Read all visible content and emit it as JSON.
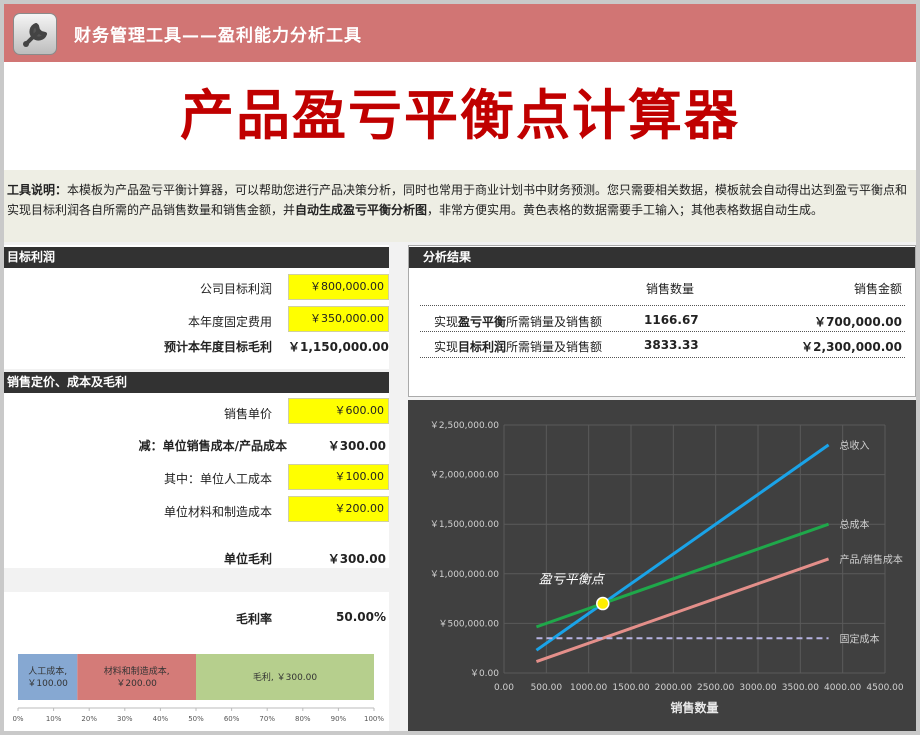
{
  "header": {
    "title": "财务管理工具——盈利能力分析工具",
    "icon": "wrench-icon"
  },
  "page_title": "产品盈亏平衡点计算器",
  "description": {
    "label": "工具说明：",
    "text1": "本模板为产品盈亏平衡计算器，可以帮助您进行产品决策分析，同时也常用于商业计划书中财务预测。您只需要相关数据，模板就会自动得出达到盈亏平衡点和实现目标利润各自所需的产品销售数量和销售金额，并",
    "bold": "自动生成盈亏平衡分析图",
    "text2": "，非常方便实用。黄色表格的数据需要手工输入；其他表格数据自动生成。"
  },
  "target_profit": {
    "title": "目标利润",
    "company_target_label": "公司目标利润",
    "company_target_value": "￥800,000.00",
    "fixed_cost_label": "本年度固定费用",
    "fixed_cost_value": "￥350,000.00",
    "target_gross_label": "预计本年度目标毛利",
    "target_gross_value": "￥1,150,000.00"
  },
  "pricing": {
    "title": "销售定价、成本及毛利",
    "unit_price_label": "销售单价",
    "unit_price_value": "￥600.00",
    "unit_cost_label": "减：单位销售成本/产品成本",
    "unit_cost_value": "￥300.00",
    "labor_label": "其中：单位人工成本",
    "labor_value": "￥100.00",
    "material_label": "单位材料和制造成本",
    "material_value": "￥200.00",
    "margin_label": "单位毛利",
    "margin_value": "￥300.00",
    "margin_rate_label": "毛利率",
    "margin_rate_value": "50.00%"
  },
  "analysis": {
    "title": "分析结果",
    "col_qty": "销售数量",
    "col_amt": "销售金额",
    "row1_prefix": "实现",
    "row1_bold": "盈亏平衡",
    "row1_suffix": "所需销量及销售额",
    "row1_qty": "1166.67",
    "row1_amt": "￥700,000.00",
    "row2_prefix": "实现",
    "row2_bold": "目标利润",
    "row2_suffix": "所需销量及销售额",
    "row2_qty": "3833.33",
    "row2_amt": "￥2,300,000.00"
  },
  "chart_data": [
    {
      "type": "line",
      "xlabel": "销售数量",
      "xlim": [
        0,
        4500
      ],
      "ylim": [
        0,
        2500000
      ],
      "x_ticks": [
        "0.00",
        "500.00",
        "1000.00",
        "1500.00",
        "2000.00",
        "2500.00",
        "3000.00",
        "3500.00",
        "4000.00",
        "4500.00"
      ],
      "y_ticks": [
        "￥0.00",
        "￥500,000.00",
        "￥1,000,000.00",
        "￥1,500,000.00",
        "￥2,000,000.00",
        "￥2,500,000.00"
      ],
      "x": [
        383.33,
        3833.33
      ],
      "series": [
        {
          "name": "总收入",
          "values": [
            230000,
            2300000
          ],
          "color": "#1aa3e8"
        },
        {
          "name": "总成本",
          "values": [
            465000,
            1500000
          ],
          "color": "#1fa84a"
        },
        {
          "name": "产品/销售成本",
          "values": [
            115000,
            1150000
          ],
          "color": "#e48f8a"
        },
        {
          "name": "固定成本",
          "values": [
            350000,
            350000
          ],
          "color": "#b6b3e2",
          "dashed": true
        }
      ],
      "annotation": {
        "label": "盈亏平衡点",
        "x": 1166.67,
        "y": 700000
      },
      "grid": true,
      "background": "#404040"
    },
    {
      "type": "bar",
      "stacked": true,
      "orientation": "horizontal",
      "x_ticks": [
        "0%",
        "10%",
        "20%",
        "30%",
        "40%",
        "50%",
        "60%",
        "70%",
        "80%",
        "90%",
        "100%"
      ],
      "segments": [
        {
          "label_line1": "人工成本,",
          "label_line2": "￥100.00",
          "value": 100,
          "color": "#86a8d2"
        },
        {
          "label_line1": "材料和制造成本,",
          "label_line2": "￥200.00",
          "value": 200,
          "color": "#d47b78"
        },
        {
          "label_line1": "毛利, ￥300.00",
          "label_line2": "",
          "value": 300,
          "color": "#b6cf8d"
        }
      ]
    }
  ]
}
